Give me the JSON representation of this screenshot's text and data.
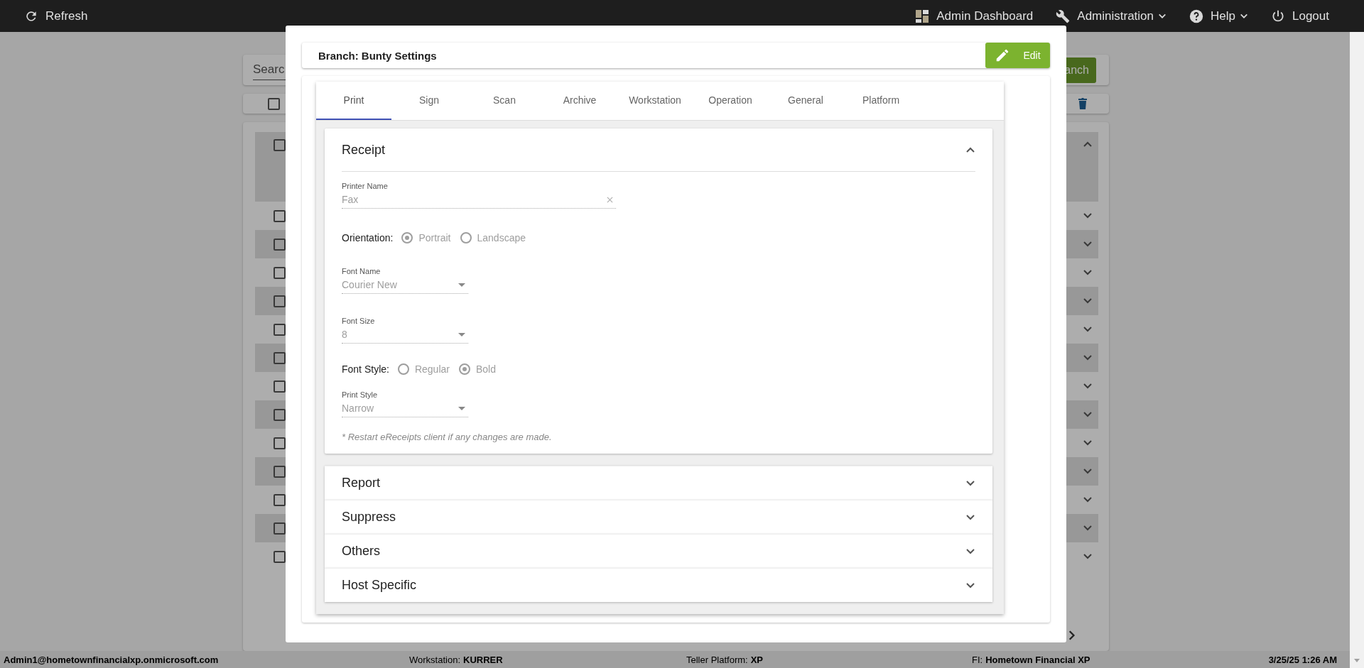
{
  "topbar": {
    "refresh": "Refresh",
    "items": [
      {
        "label": "Admin Dashboard",
        "kind": "dashboard",
        "menu": false
      },
      {
        "label": "Administration",
        "kind": "wrench",
        "menu": true
      },
      {
        "label": "Help",
        "kind": "help",
        "menu": true
      },
      {
        "label": "Logout",
        "kind": "power",
        "menu": false
      }
    ]
  },
  "background": {
    "search_placeholder": "Searc",
    "button": "anch",
    "select_all": {
      "checked": false
    },
    "rows": [
      {
        "checked": false,
        "expanded": true
      },
      {
        "checked": false,
        "expanded": false
      },
      {
        "checked": false,
        "expanded": false
      },
      {
        "checked": false,
        "expanded": false
      },
      {
        "checked": false,
        "expanded": false
      },
      {
        "checked": false,
        "expanded": false
      },
      {
        "checked": false,
        "expanded": false
      },
      {
        "checked": false,
        "expanded": false
      },
      {
        "checked": false,
        "expanded": false
      },
      {
        "checked": false,
        "expanded": false
      },
      {
        "checked": false,
        "expanded": false
      },
      {
        "checked": false,
        "expanded": false
      },
      {
        "checked": false,
        "expanded": false
      },
      {
        "checked": false,
        "expanded": false
      }
    ]
  },
  "modal": {
    "title": "Branch: Bunty Settings",
    "edit_button": "Edit",
    "tabs": [
      {
        "label": "Print",
        "selected": true
      },
      {
        "label": "Sign",
        "selected": false
      },
      {
        "label": "Scan",
        "selected": false
      },
      {
        "label": "Archive",
        "selected": false
      },
      {
        "label": "Workstation",
        "selected": false
      },
      {
        "label": "Operation",
        "selected": false
      },
      {
        "label": "General",
        "selected": false
      },
      {
        "label": "Platform",
        "selected": false
      }
    ],
    "sections": [
      {
        "title": "Receipt",
        "expanded": true,
        "disabled": true,
        "fields": [
          {
            "kind": "text",
            "label": "Printer Name",
            "value": "Fax",
            "clearable": true
          },
          {
            "kind": "radio",
            "label": "Orientation:",
            "options": [
              {
                "label": "Portrait",
                "selected": true
              },
              {
                "label": "Landscape",
                "selected": false
              }
            ]
          },
          {
            "kind": "select",
            "label": "Font Name",
            "value": "Courier New"
          },
          {
            "kind": "select",
            "label": "Font Size",
            "value": "8"
          },
          {
            "kind": "radio",
            "label": "Font Style:",
            "options": [
              {
                "label": "Regular",
                "selected": false
              },
              {
                "label": "Bold",
                "selected": true
              }
            ]
          },
          {
            "kind": "select",
            "label": "Print Style",
            "value": "Narrow"
          }
        ],
        "note": "* Restart eReceipts client if any changes are made."
      },
      {
        "title": "Report",
        "expanded": false
      },
      {
        "title": "Suppress",
        "expanded": false
      },
      {
        "title": "Others",
        "expanded": false
      },
      {
        "title": "Host Specific",
        "expanded": false
      }
    ]
  },
  "status_bar": {
    "user": "Admin1@hometownfinancialxp.onmicrosoft.com",
    "items": [
      {
        "label": "Workstation:",
        "value": "KURRER"
      },
      {
        "label": "Teller Platform:",
        "value": "XP"
      },
      {
        "label": "FI:",
        "value": "Hometown Financial XP"
      }
    ],
    "time": "3/25/25 1:26 AM"
  }
}
